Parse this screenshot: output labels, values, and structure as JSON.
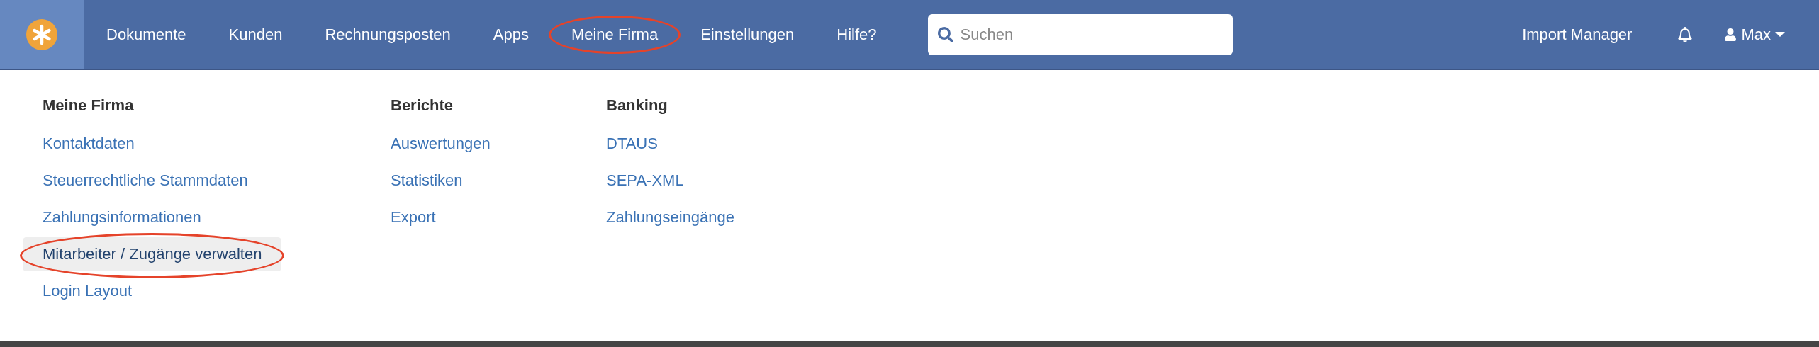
{
  "navbar": {
    "items": [
      {
        "label": "Dokumente",
        "circled": false
      },
      {
        "label": "Kunden",
        "circled": false
      },
      {
        "label": "Rechnungsposten",
        "circled": false
      },
      {
        "label": "Apps",
        "circled": false
      },
      {
        "label": "Meine Firma",
        "circled": true
      },
      {
        "label": "Einstellungen",
        "circled": false
      },
      {
        "label": "Hilfe?",
        "circled": false
      }
    ],
    "search": {
      "placeholder": "Suchen"
    },
    "import_manager": "Import Manager",
    "user": "Max"
  },
  "dropdown": {
    "columns": [
      {
        "heading": "Meine Firma",
        "items": [
          {
            "label": "Kontaktdaten",
            "selected": false,
            "circled": false
          },
          {
            "label": "Steuerrechtliche Stammdaten",
            "selected": false,
            "circled": false
          },
          {
            "label": "Zahlungsinformationen",
            "selected": false,
            "circled": false
          },
          {
            "label": "Mitarbeiter / Zugänge verwalten",
            "selected": true,
            "circled": true
          },
          {
            "label": "Login Layout",
            "selected": false,
            "circled": false
          }
        ]
      },
      {
        "heading": "Berichte",
        "items": [
          {
            "label": "Auswertungen",
            "selected": false,
            "circled": false
          },
          {
            "label": "Statistiken",
            "selected": false,
            "circled": false
          },
          {
            "label": "Export",
            "selected": false,
            "circled": false
          }
        ]
      },
      {
        "heading": "Banking",
        "items": [
          {
            "label": "DTAUS",
            "selected": false,
            "circled": false
          },
          {
            "label": "SEPA-XML",
            "selected": false,
            "circled": false
          },
          {
            "label": "Zahlungseingänge",
            "selected": false,
            "circled": false
          }
        ]
      }
    ]
  }
}
